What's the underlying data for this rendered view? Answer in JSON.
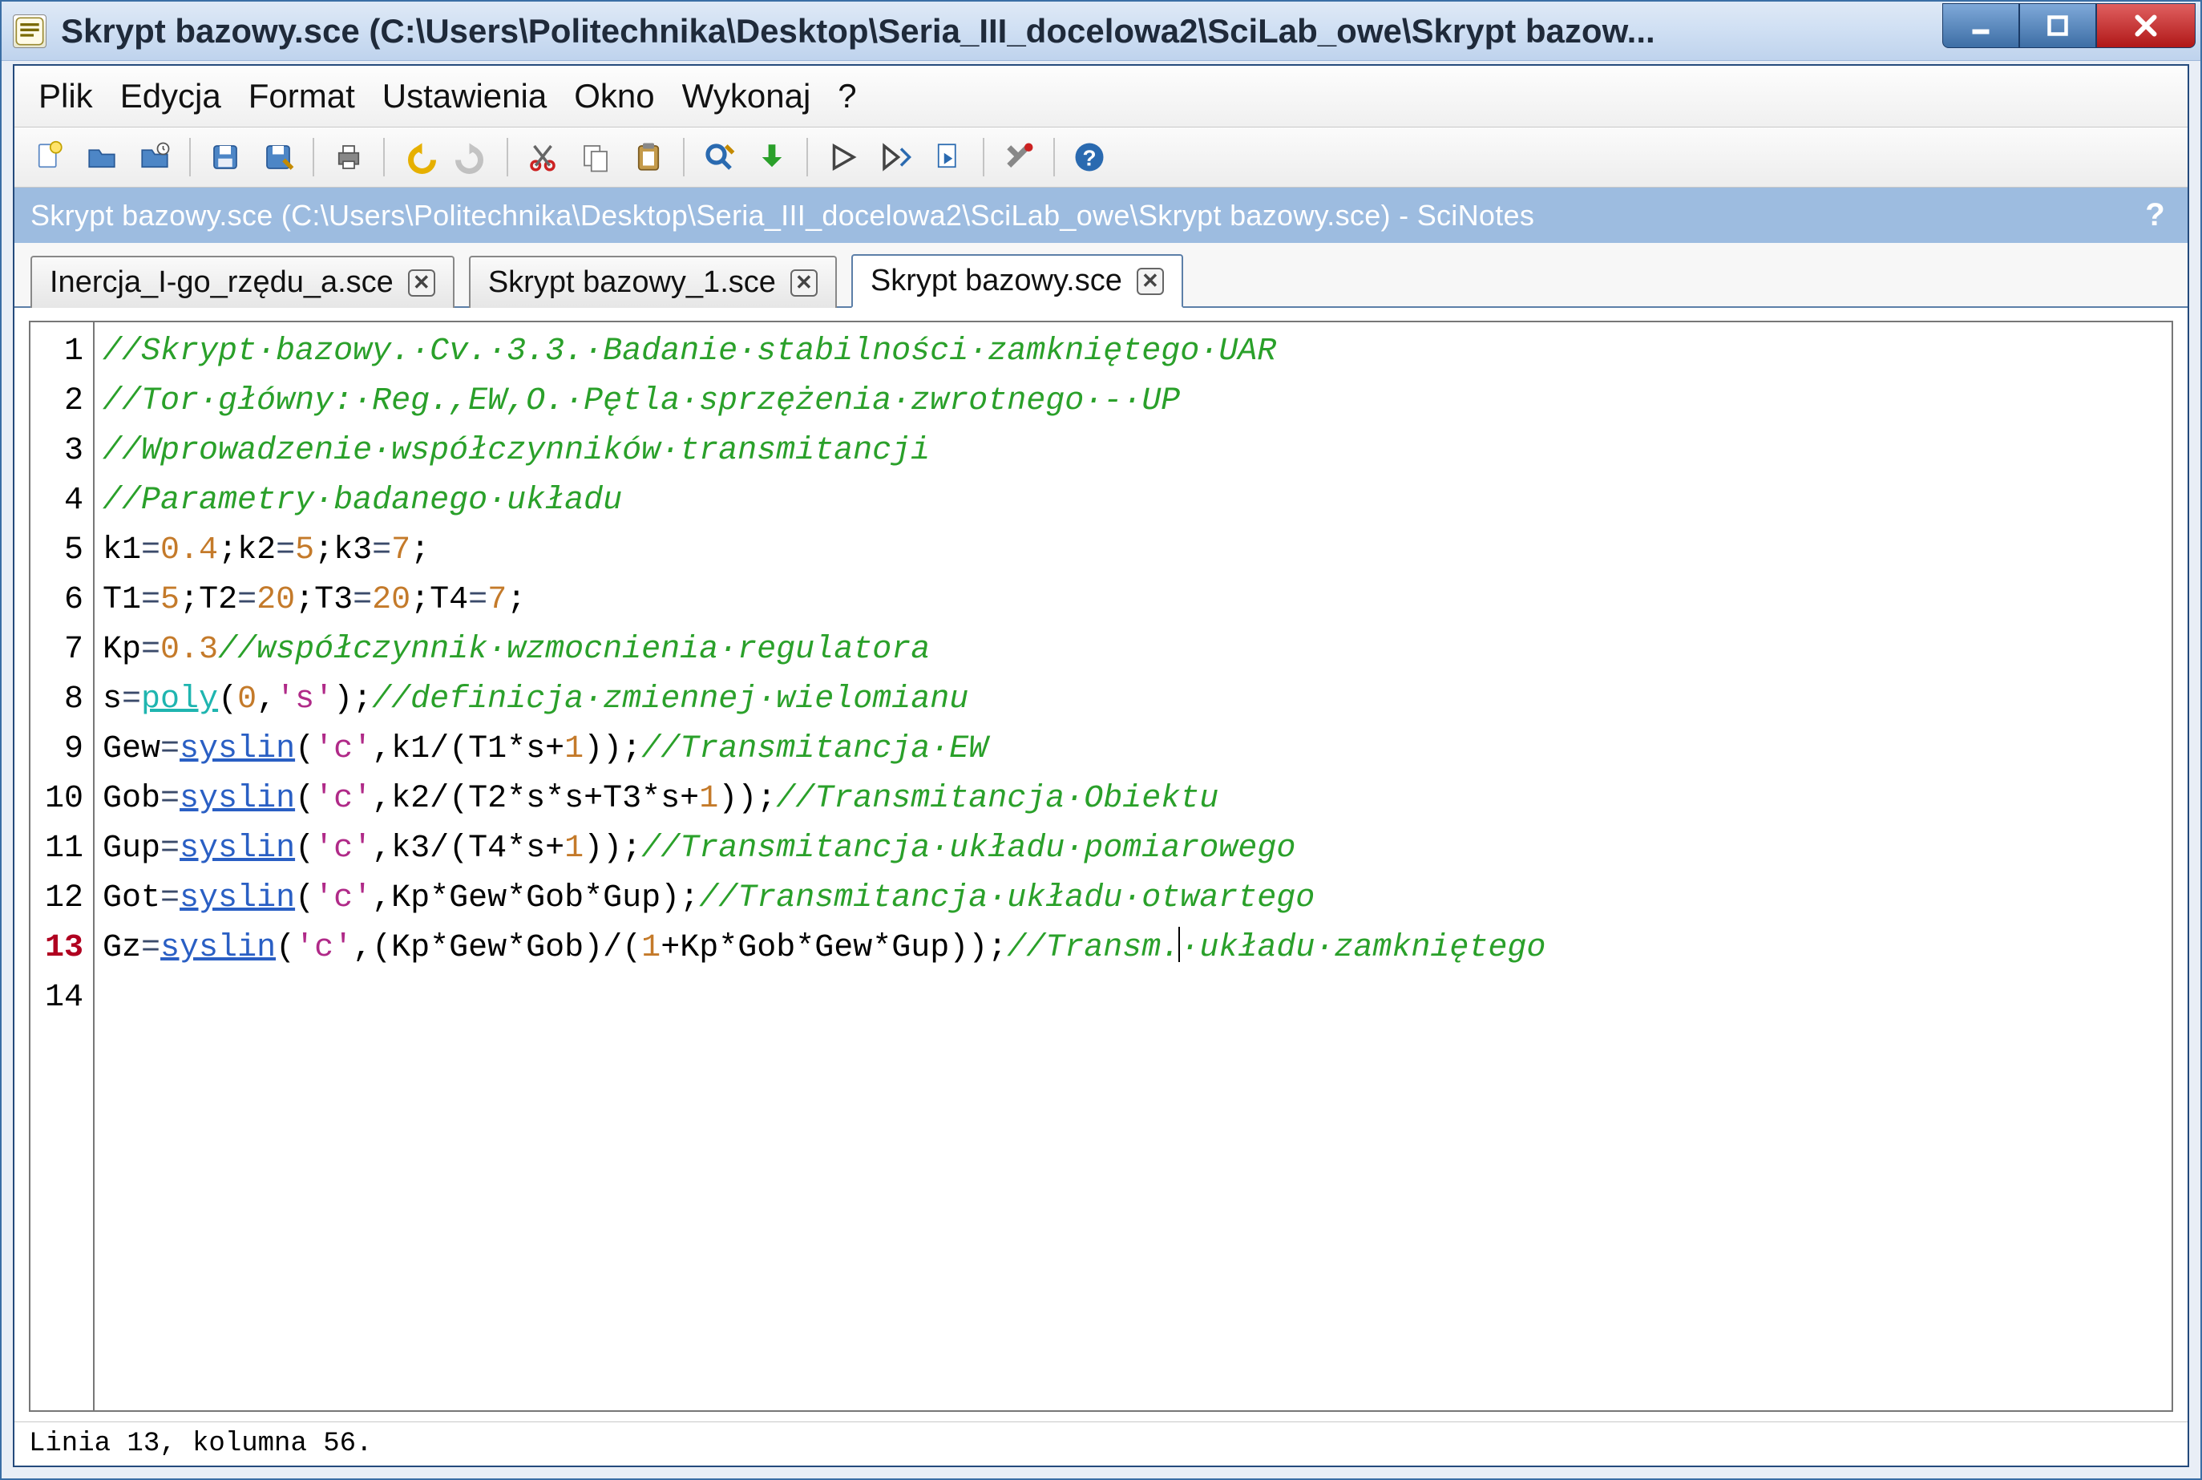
{
  "window": {
    "title": "Skrypt bazowy.sce (C:\\Users\\Politechnika\\Desktop\\Seria_III_docelowa2\\SciLab_owe\\Skrypt bazow..."
  },
  "menu": {
    "plik": "Plik",
    "edycja": "Edycja",
    "format": "Format",
    "ustawienia": "Ustawienia",
    "okno": "Okno",
    "wykonaj": "Wykonaj",
    "help": "?"
  },
  "toolbar_icons": {
    "new": "new-file-icon",
    "open": "open-file-icon",
    "recent": "open-recent-icon",
    "save": "save-icon",
    "saveas": "save-as-icon",
    "print": "print-icon",
    "undo": "undo-icon",
    "redo": "redo-icon",
    "cut": "cut-icon",
    "copy": "copy-icon",
    "paste": "paste-icon",
    "find": "find-replace-icon",
    "download": "import-icon",
    "run": "run-icon",
    "run_in": "run-into-icon",
    "run_file": "run-file-icon",
    "prefs": "preferences-icon",
    "help": "help-icon"
  },
  "doc_header": {
    "text": "Skrypt bazowy.sce (C:\\Users\\Politechnika\\Desktop\\Seria_III_docelowa2\\SciLab_owe\\Skrypt bazowy.sce) - SciNotes",
    "help": "?"
  },
  "tabs": [
    {
      "label": "Inercja_I-go_rzędu_a.sce",
      "active": false
    },
    {
      "label": "Skrypt bazowy_1.sce",
      "active": false
    },
    {
      "label": "Skrypt bazowy.sce",
      "active": true
    }
  ],
  "editor": {
    "active_line": 13,
    "line_count": 14,
    "code": {
      "l1": "//Skrypt·bazowy.·Cv.·3.3.·Badanie·stabilności·zamkniętego·UAR",
      "l2": "//Tor·główny:·Reg.,EW,O.·Pętla·sprzężenia·zwrotnego·-·UP",
      "l3": "//Wprowadzenie·współczynników·transmitancji",
      "l4": "//Parametry·badanego·układu",
      "l5_a": "k1",
      "l5_b": "=",
      "l5_c": "0.4",
      "l5_d": ";k2",
      "l5_e": "=",
      "l5_f": "5",
      "l5_g": ";k3",
      "l5_h": "=",
      "l5_i": "7",
      "l5_j": ";",
      "l6_a": "T1",
      "l6_b": "=",
      "l6_c": "5",
      "l6_d": ";T2",
      "l6_e": "=",
      "l6_f": "20",
      "l6_g": ";T3",
      "l6_h": "=",
      "l6_i": "20",
      "l6_j": ";T4",
      "l6_k": "=",
      "l6_l": "7",
      "l6_m": ";",
      "l7_a": "Kp",
      "l7_b": "=",
      "l7_c": "0.3",
      "l7_d": "//współczynnik·wzmocnienia·regulatora",
      "l8_a": "s",
      "l8_b": "=",
      "l8_c": "poly",
      "l8_d": "(",
      "l8_e": "0",
      "l8_f": ",",
      "l8_g": "'s'",
      "l8_h": ");",
      "l8_i": "//definicja·zmiennej·wielomianu",
      "l9_a": "Gew",
      "l9_b": "=",
      "l9_c": "syslin",
      "l9_d": "(",
      "l9_e": "'c'",
      "l9_f": ",k1/(T1*s+",
      "l9_g": "1",
      "l9_h": "));",
      "l9_i": "//Transmitancja·EW",
      "l10_a": "Gob",
      "l10_b": "=",
      "l10_c": "syslin",
      "l10_d": "(",
      "l10_e": "'c'",
      "l10_f": ",k2/(T2*s*s+T3*s+",
      "l10_g": "1",
      "l10_h": "));",
      "l10_i": "//Transmitancja·Obiektu",
      "l11_a": "Gup",
      "l11_b": "=",
      "l11_c": "syslin",
      "l11_d": "(",
      "l11_e": "'c'",
      "l11_f": ",k3/(T4*s+",
      "l11_g": "1",
      "l11_h": "));",
      "l11_i": "//Transmitancja·układu·pomiarowego",
      "l12_a": "Got",
      "l12_b": "=",
      "l12_c": "syslin",
      "l12_d": "(",
      "l12_e": "'c'",
      "l12_f": ",Kp*Gew*Gob*Gup);",
      "l12_g": "//Transmitancja·układu·otwartego",
      "l13_a": "Gz",
      "l13_b": "=",
      "l13_c": "syslin",
      "l13_d": "(",
      "l13_e": "'c'",
      "l13_f": ",(Kp*Gew*Gob)/(",
      "l13_g": "1",
      "l13_h": "+Kp*Gob*Gew*Gup));",
      "l13_i1": "//Transm.",
      "l13_i2": "·układu·zamkniętego"
    }
  },
  "statusbar": {
    "text": "Linia 13, kolumna 56."
  },
  "gutter": {
    "1": "1",
    "2": "2",
    "3": "3",
    "4": "4",
    "5": "5",
    "6": "6",
    "7": "7",
    "8": "8",
    "9": "9",
    "10": "10",
    "11": "11",
    "12": "12",
    "13": "13",
    "14": "14"
  }
}
